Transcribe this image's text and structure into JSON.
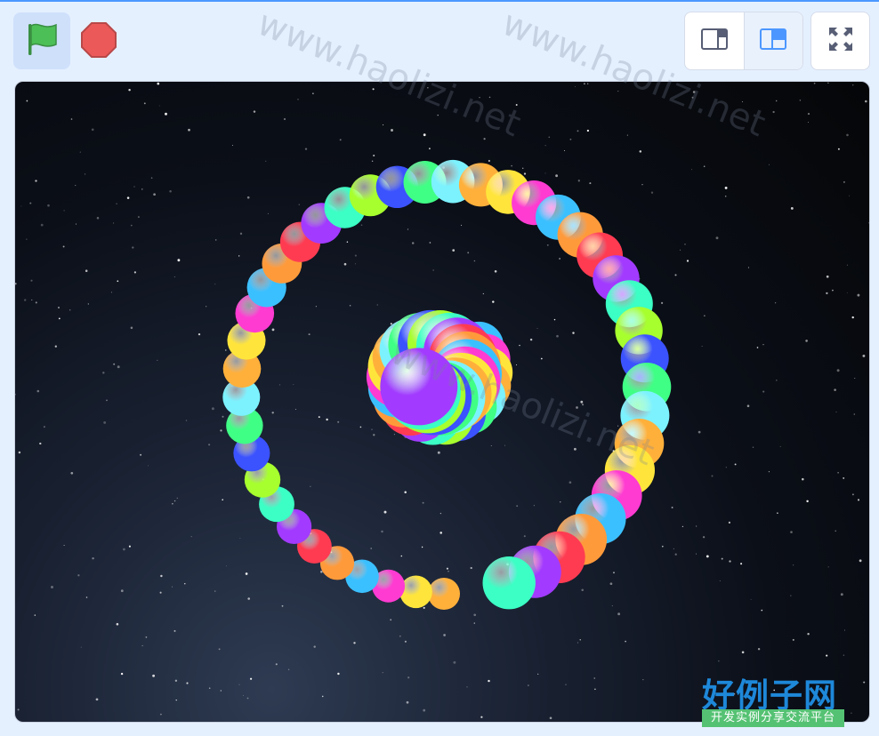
{
  "toolbar": {
    "green_flag_icon": "green-flag-icon",
    "stop_icon": "stop-sign-icon",
    "small_stage_icon": "small-stage-mode-icon",
    "normal_stage_icon": "normal-stage-mode-icon",
    "fullscreen_icon": "fullscreen-icon",
    "active_mode": "normal"
  },
  "stage": {
    "background": "starry-night-sky",
    "sprite": "colored-ball-spiral",
    "ball_colors": [
      "#ffb03b",
      "#ff3b52",
      "#40ff85",
      "#3bc0ff",
      "#a7ff2e",
      "#ffe53b",
      "#a23bff",
      "#7cf2ff",
      "#ff9a3b",
      "#3b52ff",
      "#ff3bd2",
      "#3bffc4"
    ]
  },
  "watermark": {
    "text": "www.haolizi.net"
  },
  "brand": {
    "title": "好例子网",
    "subtitle": "开发实例分享交流平台"
  },
  "colors": {
    "accent": "#4c97ff",
    "flag_green": "#4cbf56",
    "stop_red": "#ec5959"
  }
}
